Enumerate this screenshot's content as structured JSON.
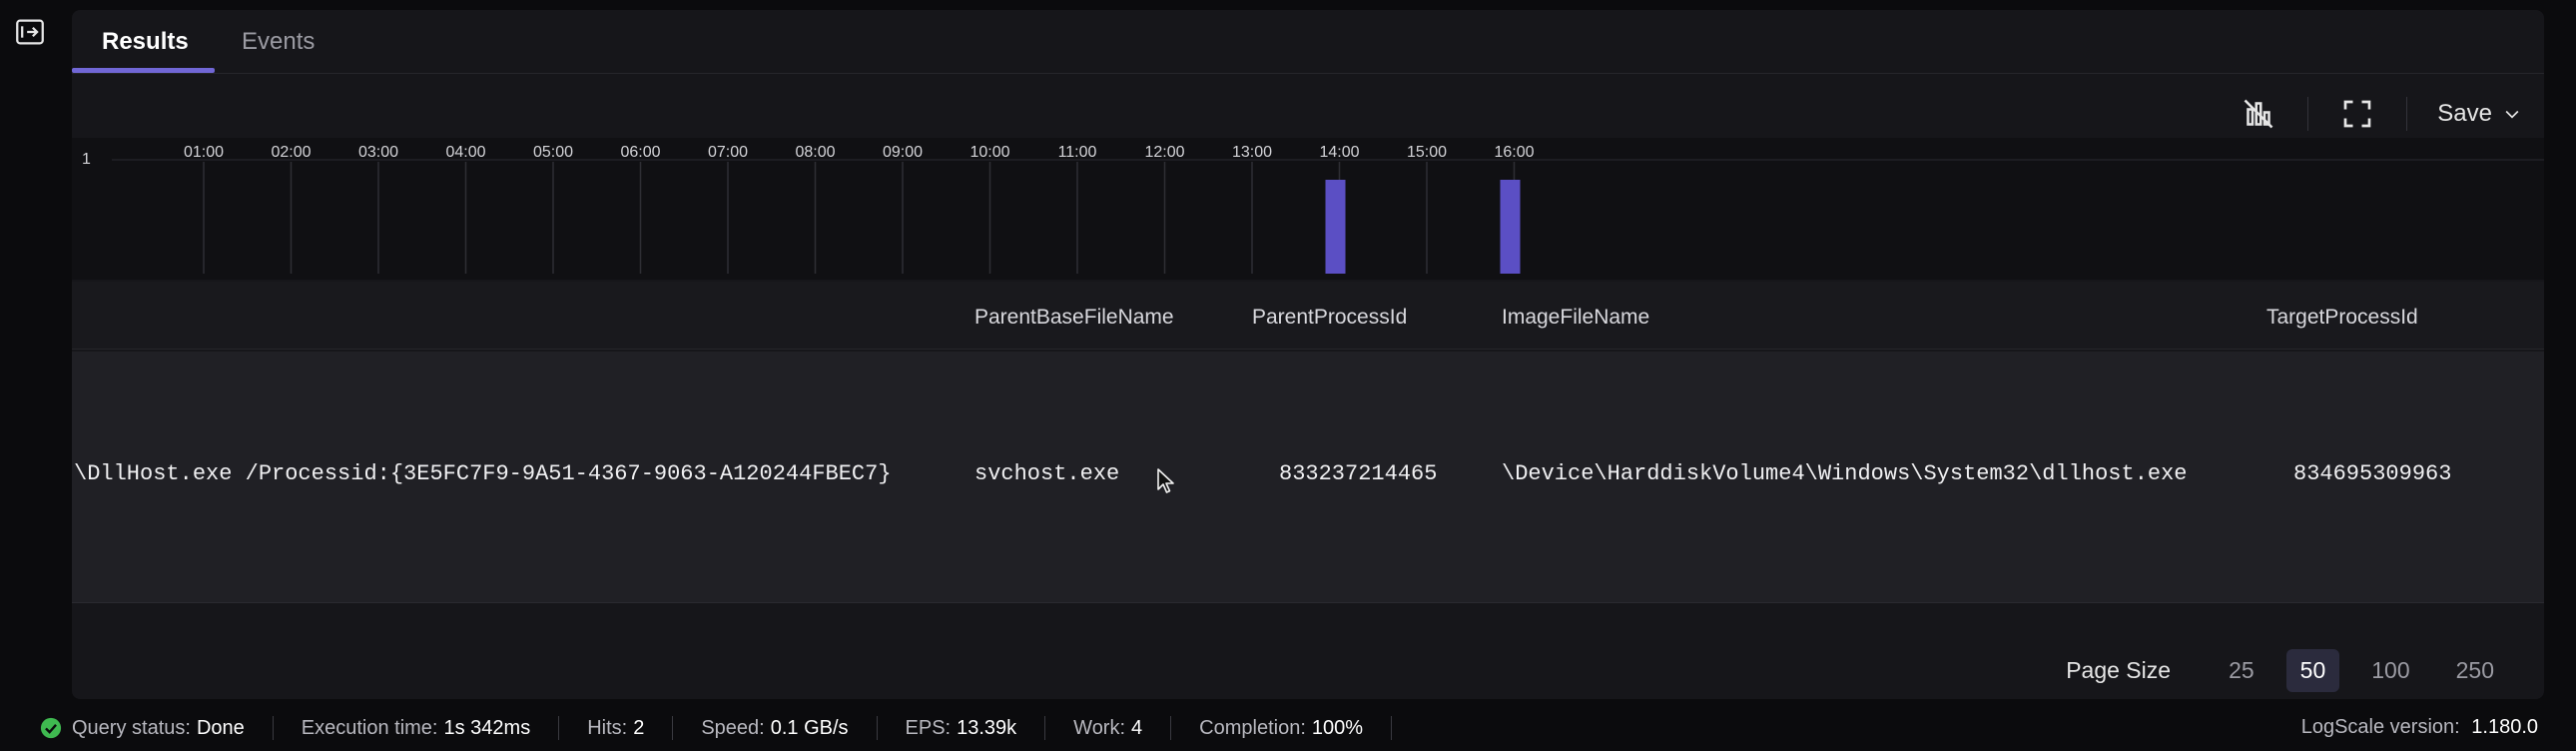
{
  "tabs": [
    {
      "label": "Results",
      "active": true
    },
    {
      "label": "Events",
      "active": false
    }
  ],
  "toolbar": {
    "hide_chart_icon": "chart-off-icon",
    "fullscreen_icon": "fullscreen-icon",
    "save_label": "Save"
  },
  "histogram": {
    "y_max_label": "1",
    "ticks": [
      "01:00",
      "02:00",
      "03:00",
      "04:00",
      "05:00",
      "06:00",
      "07:00",
      "08:00",
      "09:00",
      "10:00",
      "11:00",
      "12:00",
      "13:00",
      "14:00",
      "15:00",
      "16:00"
    ],
    "bars": [
      {
        "time": "14:00",
        "count": 1
      },
      {
        "time": "16:00",
        "count": 1
      }
    ],
    "bar_color": "#5b4fc4"
  },
  "table": {
    "columns": [
      "ParentBaseFileName",
      "ParentProcessId",
      "ImageFileName",
      "TargetProcessId"
    ],
    "rows": [
      {
        "command_line": "\\DllHost.exe /Processid:{3E5FC7F9-9A51-4367-9063-A120244FBEC7}",
        "ParentBaseFileName": "svchost.exe",
        "ParentProcessId": "833237214465",
        "ImageFileName": "\\Device\\HarddiskVolume4\\Windows\\System32\\dllhost.exe",
        "TargetProcessId": "834695309963"
      }
    ]
  },
  "pager": {
    "label": "Page Size",
    "options": [
      "25",
      "50",
      "100",
      "250"
    ],
    "selected": "50"
  },
  "status": {
    "query_status_label": "Query status:",
    "query_status_value": "Done",
    "execution_label": "Execution time:",
    "execution_value": "1s 342ms",
    "hits_label": "Hits:",
    "hits_value": "2",
    "speed_label": "Speed:",
    "speed_value": "0.1 GB/s",
    "eps_label": "EPS:",
    "eps_value": "13.39k",
    "work_label": "Work:",
    "work_value": "4",
    "completion_label": "Completion:",
    "completion_value": "100%",
    "version_label": "LogScale version:",
    "version_value": "1.180.0",
    "done_color": "#3fb950"
  }
}
